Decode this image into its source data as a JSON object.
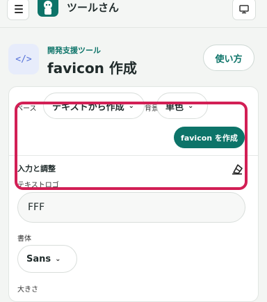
{
  "app": {
    "name": "ツールさん"
  },
  "header": {
    "category": "開発支援ツール",
    "title": "favicon 作成",
    "tool_icon_glyph": "</>",
    "howto_label": "使い方"
  },
  "form": {
    "base_label": "ベース",
    "mode_value": "テキストから作成",
    "bg_label": "背景",
    "color_value": "単色",
    "create_label": "favicon を作成",
    "section_title": "入力と調整",
    "text_label": "テキストロゴ",
    "text_value": "FFF",
    "font_label": "書体",
    "font_value": "Sans",
    "size_label": "大きさ"
  },
  "colors": {
    "accent": "#0d7469",
    "highlight": "#d21f55",
    "icon_bg": "#e7ecfb",
    "icon_fg": "#5672d8"
  },
  "icons": [
    "menu-icon",
    "app-logo-icon",
    "screen-icon",
    "code-icon",
    "chevron-down-icon",
    "eraser-icon"
  ]
}
